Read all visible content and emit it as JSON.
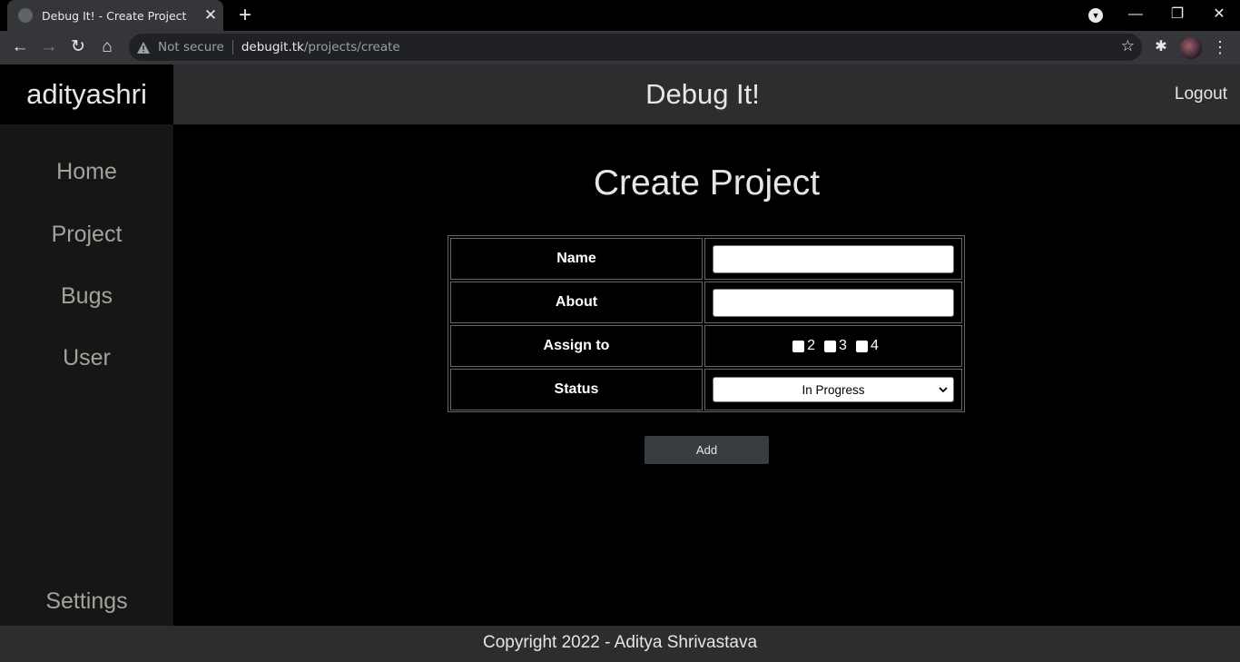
{
  "browser": {
    "tab_title": "Debug It! - Create Project",
    "new_tab_label": "+",
    "security_label": "Not secure",
    "url_host": "debugit.tk",
    "url_path": "/projects/create"
  },
  "app": {
    "brand": "adityashri",
    "title": "Debug It!",
    "logout_label": "Logout"
  },
  "sidebar": {
    "items": [
      {
        "label": "Home"
      },
      {
        "label": "Project"
      },
      {
        "label": "Bugs"
      },
      {
        "label": "User"
      }
    ],
    "settings_label": "Settings"
  },
  "form": {
    "heading": "Create Project",
    "name_label": "Name",
    "name_value": "",
    "about_label": "About",
    "about_value": "",
    "assign_label": "Assign to",
    "assign_options": [
      "2",
      "3",
      "4"
    ],
    "status_label": "Status",
    "status_value": "In Progress",
    "submit_label": "Add"
  },
  "footer": {
    "copyright": "Copyright 2022 - Aditya Shrivastava"
  },
  "colors": {
    "topbar": "#2b2d2f",
    "sidebar": "#151616",
    "sidebar_text": "#a5a29a",
    "button": "#3a3d40"
  }
}
